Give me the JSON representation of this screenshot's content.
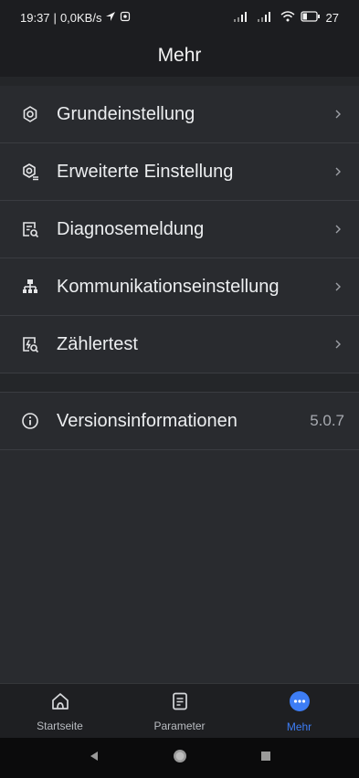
{
  "status_bar": {
    "time": "19:37",
    "speed": "0,0KB/s",
    "battery": "27"
  },
  "header": {
    "title": "Mehr"
  },
  "menu": [
    {
      "label": "Grundeinstellung",
      "icon": "settings-gear-icon"
    },
    {
      "label": "Erweiterte Einstellung",
      "icon": "advanced-settings-icon"
    },
    {
      "label": "Diagnosemeldung",
      "icon": "diagnostic-report-icon"
    },
    {
      "label": "Kommunikationseinstellung",
      "icon": "network-topology-icon"
    },
    {
      "label": "Zählertest",
      "icon": "meter-test-icon"
    }
  ],
  "version": {
    "label": "Versionsinformationen",
    "value": "5.0.7",
    "icon": "info-icon"
  },
  "bottom_nav": {
    "tabs": [
      {
        "label": "Startseite",
        "icon": "home-icon",
        "active": false
      },
      {
        "label": "Parameter",
        "icon": "document-icon",
        "active": false
      },
      {
        "label": "Mehr",
        "icon": "more-dots-icon",
        "active": true
      }
    ],
    "active_color": "#3d7df5"
  }
}
